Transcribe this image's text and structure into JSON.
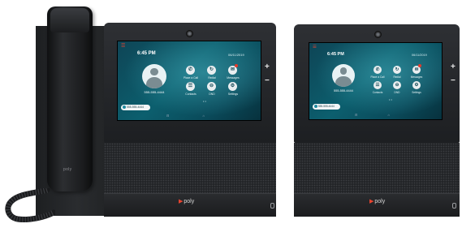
{
  "product": {
    "brand": "poly",
    "handset_brand": "poly"
  },
  "screen": {
    "time": "6:45 PM",
    "date": "06/11/2019",
    "caller_number": "555-555-4444",
    "tiles": [
      {
        "label": "Place a Call",
        "icon": "phone-icon"
      },
      {
        "label": "Redial",
        "icon": "redial-icon"
      },
      {
        "label": "Messages",
        "icon": "message-icon",
        "badge": true
      },
      {
        "label": "Contacts",
        "icon": "contacts-icon"
      },
      {
        "label": "DND",
        "icon": "dnd-icon"
      },
      {
        "label": "Settings",
        "icon": "gear-icon"
      }
    ],
    "line_pill": "555-555-4444",
    "page_dots": "• •",
    "nav_bar": "⊟ ⌂"
  },
  "volume": {
    "plus": "+",
    "minus": "−"
  },
  "colors": {
    "body": "#232528",
    "screen": "#0c5f6e",
    "brand_accent": "#e8432f",
    "badge": "#e33b2c"
  }
}
